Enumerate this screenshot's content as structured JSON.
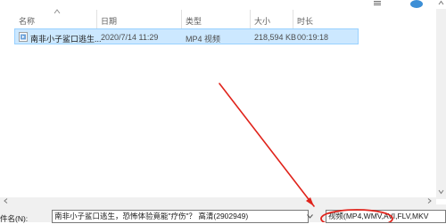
{
  "header": {
    "columns": [
      {
        "label": "名称"
      },
      {
        "label": "日期"
      },
      {
        "label": "类型"
      },
      {
        "label": "大小"
      },
      {
        "label": "时长"
      }
    ]
  },
  "files": [
    {
      "name": "南非小子鲨口逃生...",
      "date": "2020/7/14 11:29",
      "type": "MP4 视频",
      "size": "218,594 KB",
      "duration": "00:19:18",
      "selected": true
    }
  ],
  "footer": {
    "filename_label": "件名(N):",
    "filename_value": "南非小子鲨口逃生，恐怖体验竟能\"疗伤\"？ 高清(2902949)",
    "filetype_value": "视频(MP4,WMV,AVI,FLV,MKV"
  },
  "colors": {
    "selection_bg": "#cce8ff",
    "selection_border": "#99d1ff",
    "annotation_red": "#e0231b"
  },
  "icons": [
    "details-view-icon",
    "help-icon",
    "sort-up-icon",
    "video-file-icon",
    "dropdown-arrow-icon"
  ]
}
